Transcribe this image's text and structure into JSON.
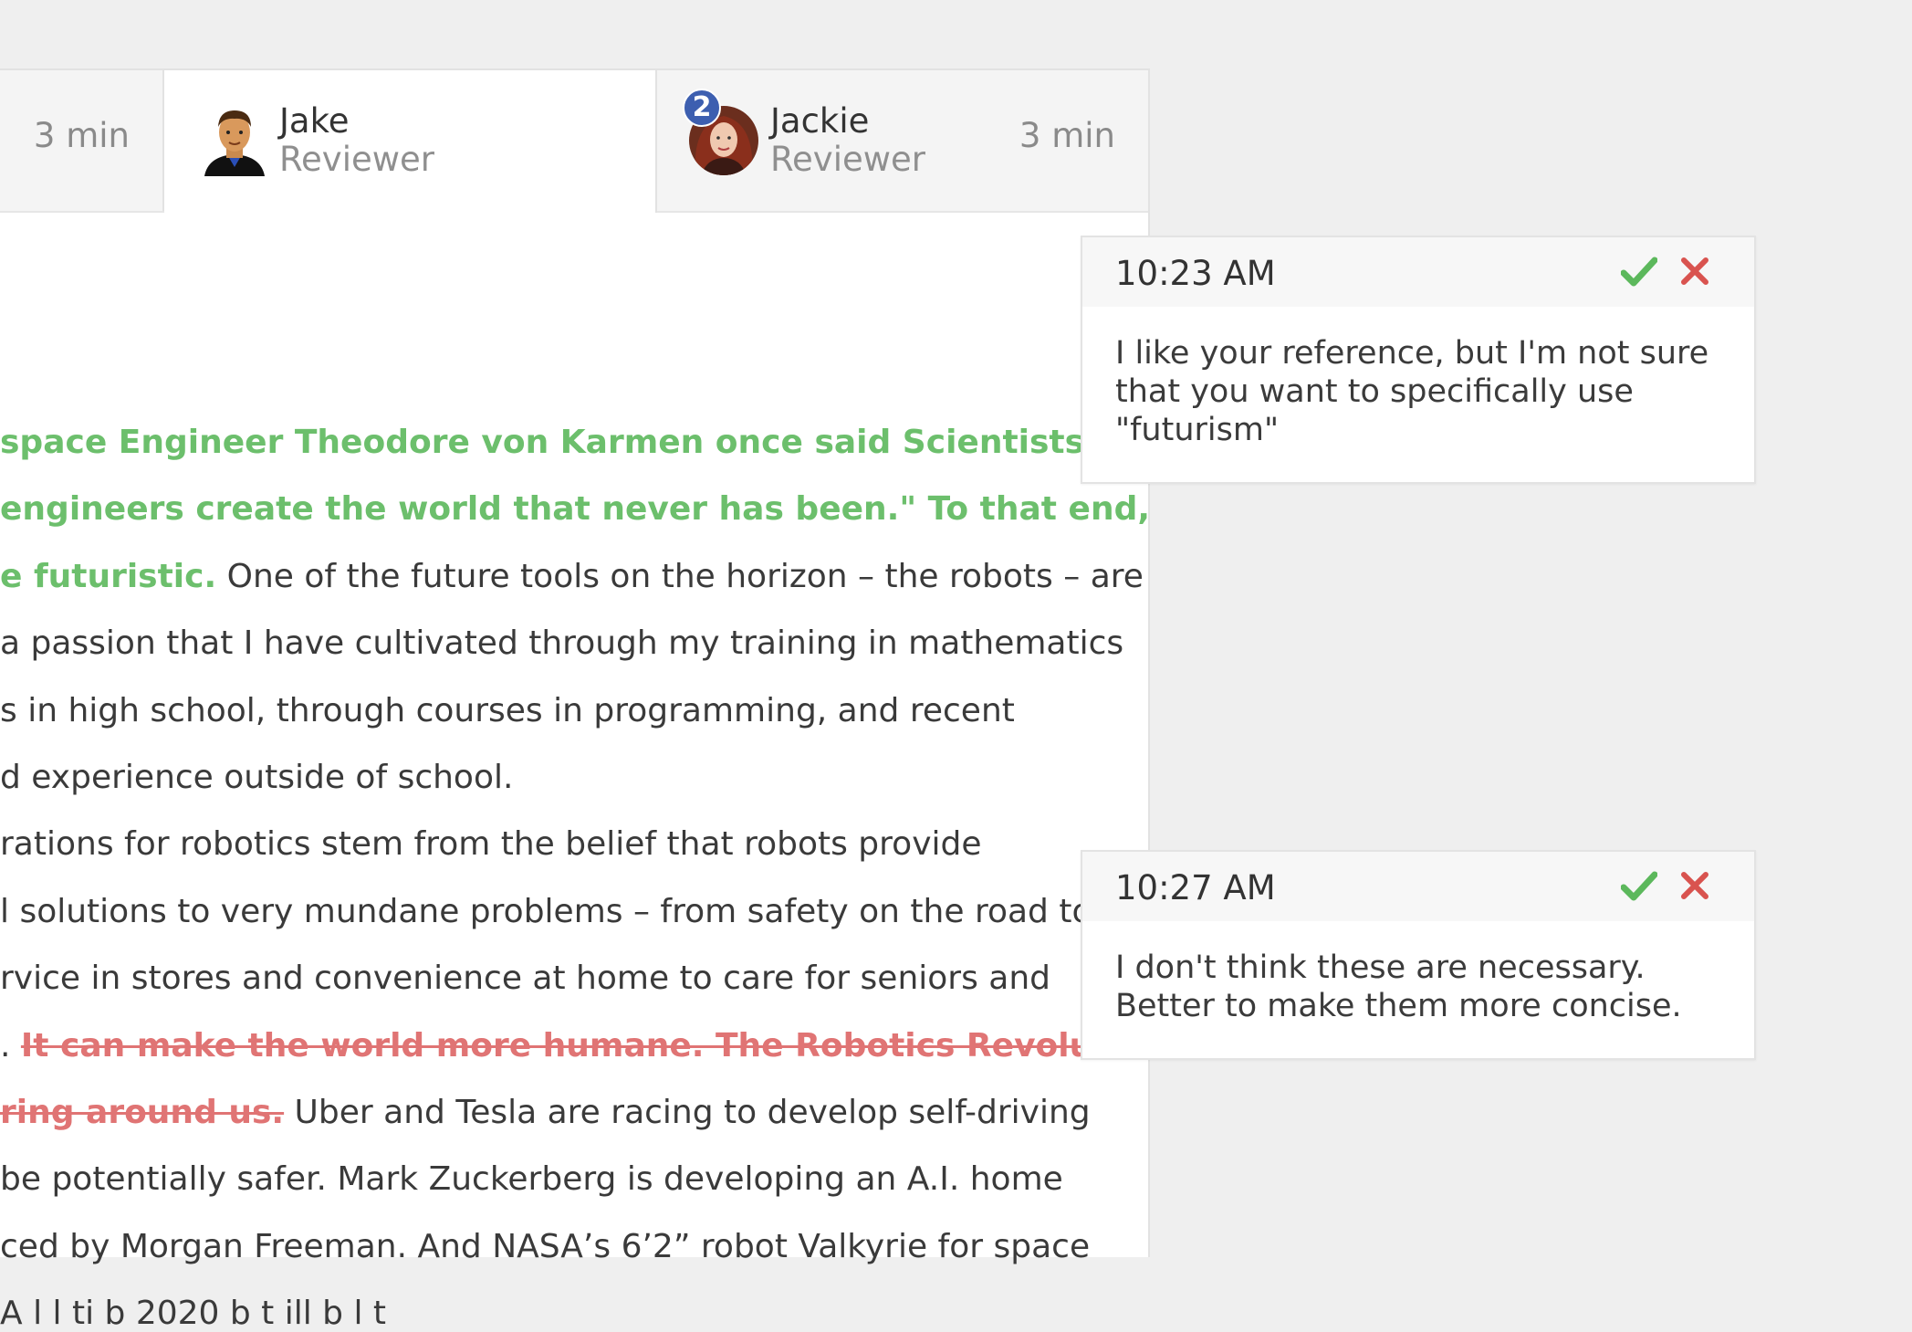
{
  "tabs": [
    {
      "time": "3 min"
    },
    {
      "name": "Jake",
      "role": "Reviewer"
    },
    {
      "name": "Jackie",
      "role": "Reviewer",
      "badge": "2",
      "time": "3 min"
    }
  ],
  "document": {
    "lines": [
      [
        {
          "t": "space Engineer Theodore von Karmen once said Scientists study the",
          "k": "ins"
        }
      ],
      [
        {
          "t": "engineers create the world that never has been.\" To that end,",
          "k": "ins"
        }
      ],
      [
        {
          "t": "e futuristic.",
          "k": "ins"
        },
        {
          "t": " One of the future tools on the horizon – the robots – are",
          "k": ""
        }
      ],
      [
        {
          "t": "a passion that I have cultivated through my training in mathematics",
          "k": ""
        }
      ],
      [
        {
          "t": "s in high school, through courses in programming, and recent",
          "k": ""
        }
      ],
      [
        {
          "t": "d experience outside of school.",
          "k": ""
        }
      ],
      [
        {
          "t": "rations for robotics stem from the belief that robots provide",
          "k": ""
        }
      ],
      [
        {
          "t": "l solutions to very mundane problems – from safety on the road to",
          "k": ""
        }
      ],
      [
        {
          "t": "rvice in stores and convenience at home to care for seniors and",
          "k": ""
        }
      ],
      [
        {
          "t": ". ",
          "k": ""
        },
        {
          "t": "It can make the world more humane. The Robotics Revolution is",
          "k": "del"
        }
      ],
      [
        {
          "t": "ring around us.",
          "k": "del"
        },
        {
          "t": " Uber and Tesla are racing to develop self-driving",
          "k": ""
        }
      ],
      [
        {
          "t": " be potentially safer. Mark Zuckerberg is developing an A.I. home",
          "k": ""
        }
      ],
      [
        {
          "t": "ced by Morgan Freeman. And NASA’s 6’2” robot Valkyrie for space",
          "k": ""
        }
      ],
      [
        {
          "t": "A                    l  l  ti   b  2020     b  t   ill b                    l  t",
          "k": ""
        }
      ]
    ]
  },
  "comments": [
    {
      "time": "10:23 AM",
      "text": "I like your reference, but I'm not sure that you want to specifically use \"futurism\""
    },
    {
      "time": "10:27 AM",
      "text": "I don't think these are necessary. Better to make them more concise."
    }
  ],
  "colors": {
    "insert": "#6cbf6c",
    "delete": "#e07474",
    "accept": "#5cb85c",
    "reject": "#d9534f"
  }
}
